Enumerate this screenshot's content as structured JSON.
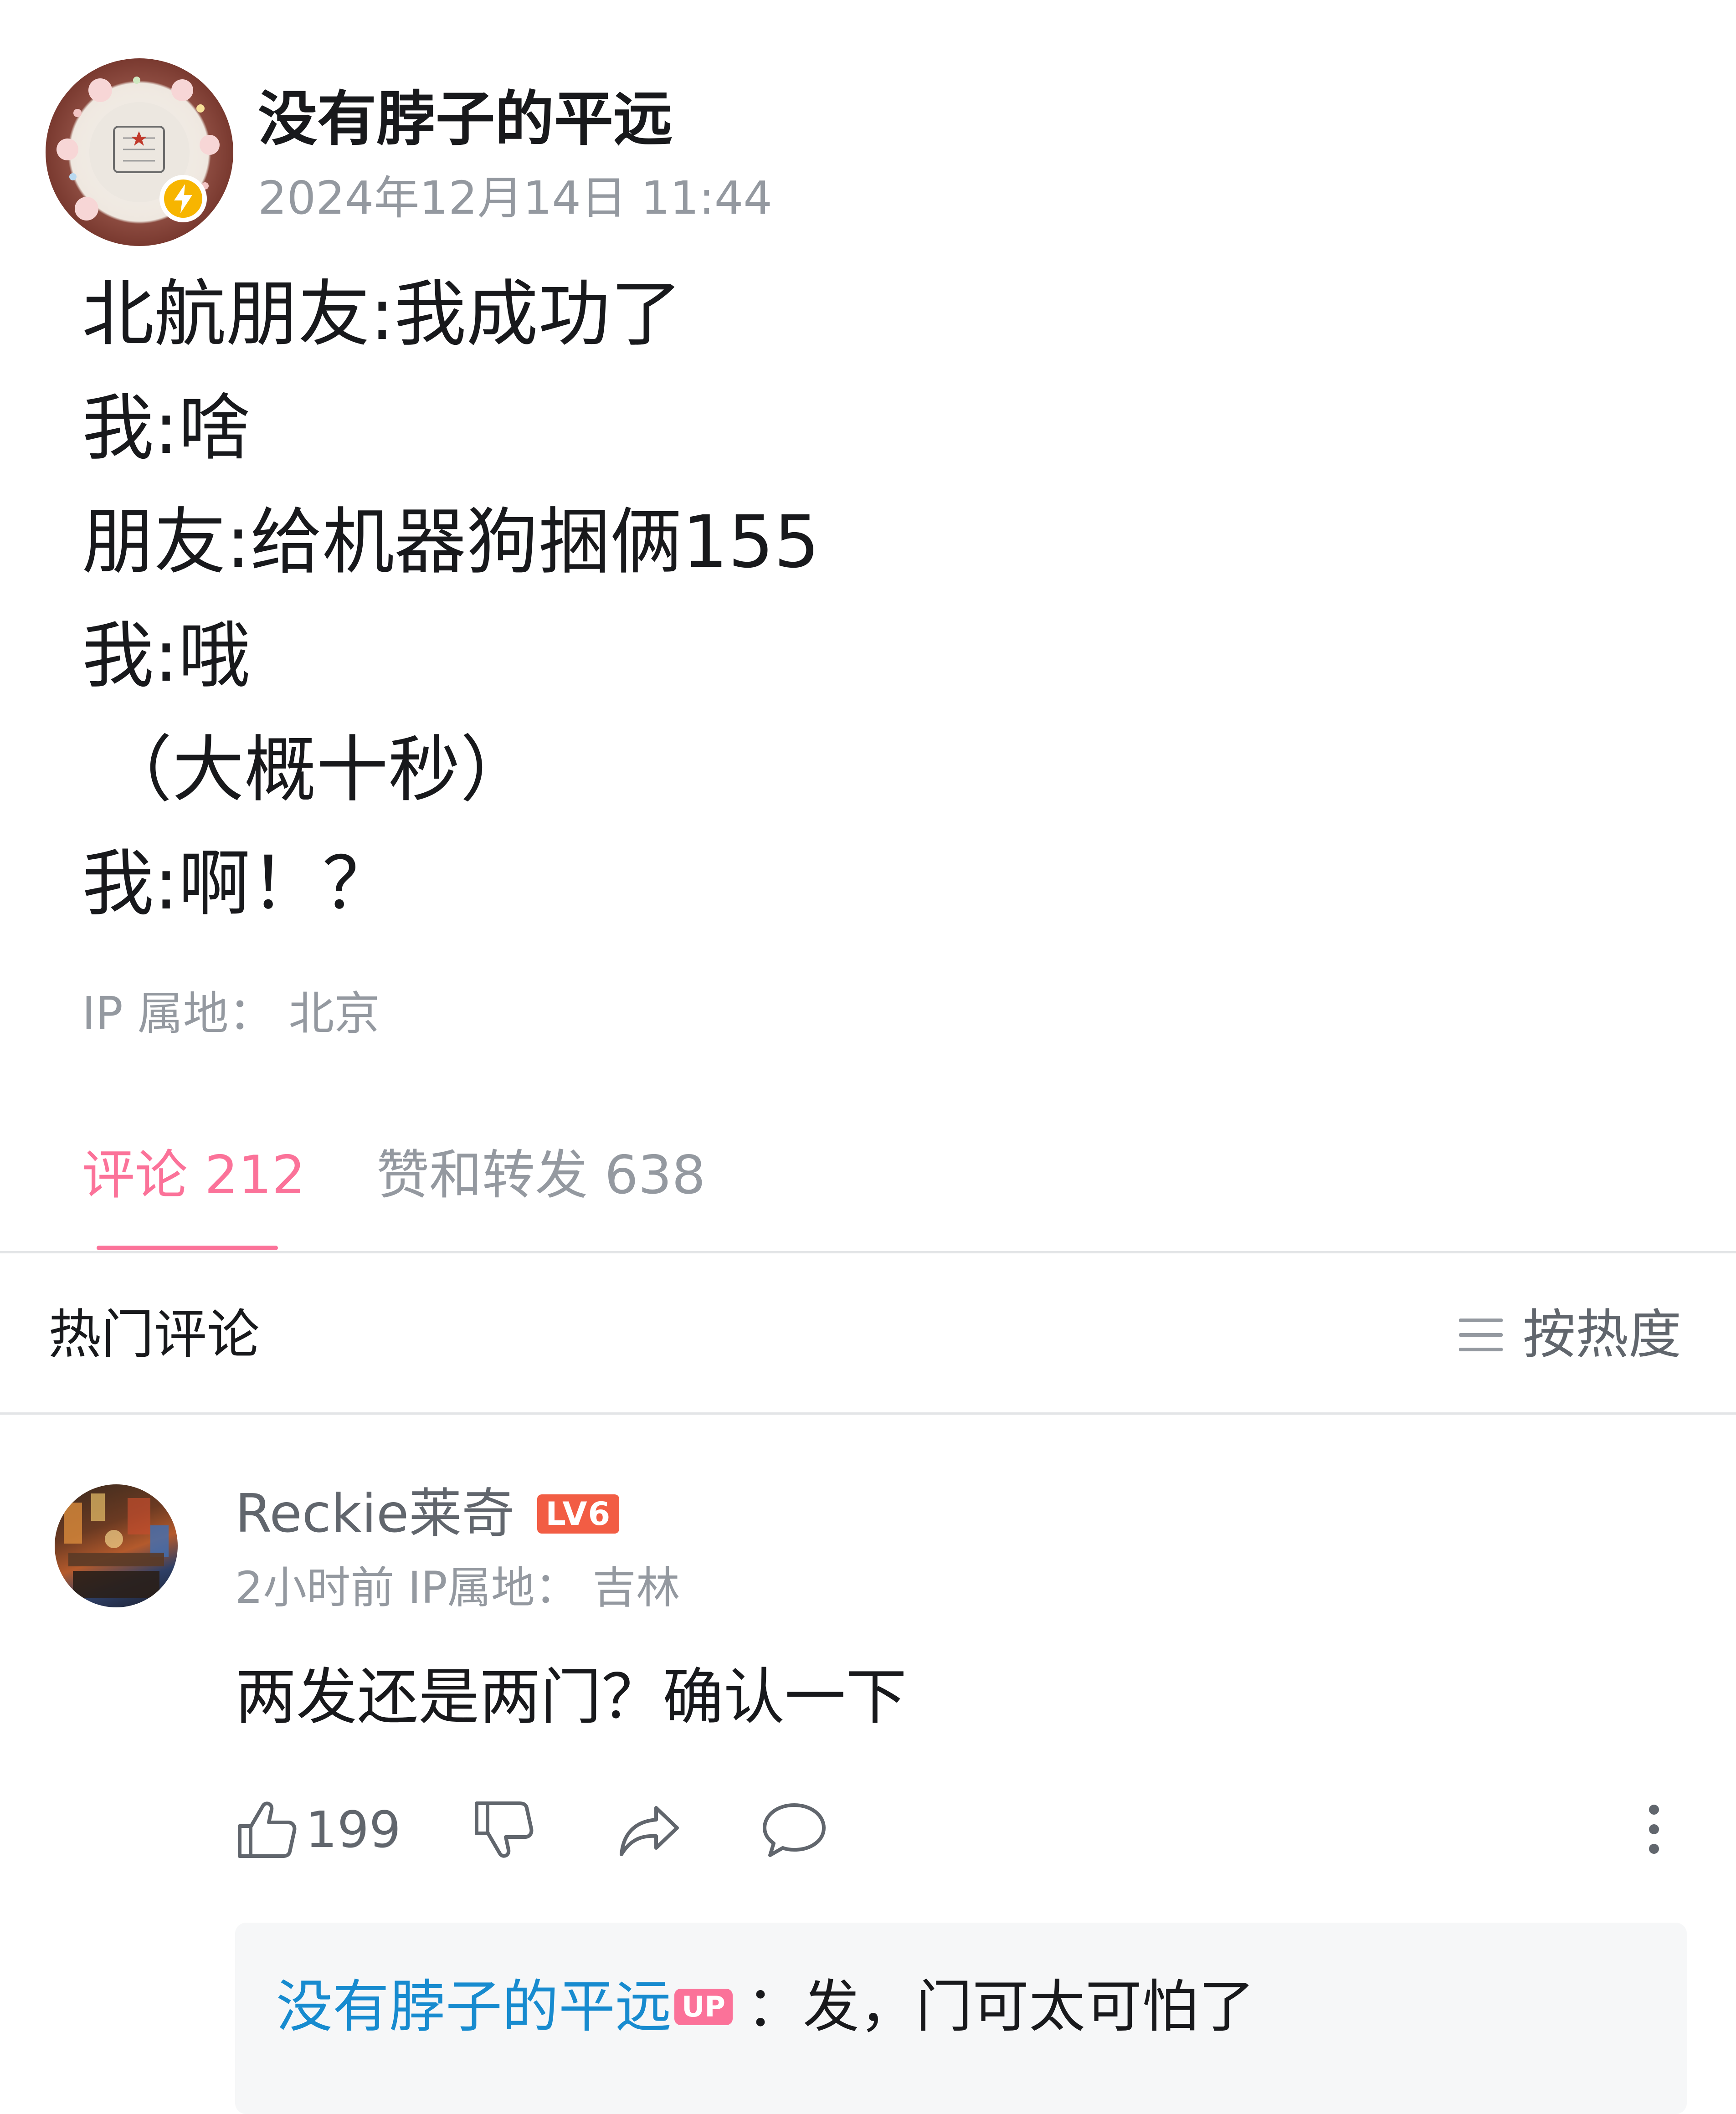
{
  "post": {
    "author": "没有脖子的平远",
    "time": "2024年12月14日 11:44",
    "lines": [
      "北航朋友:我成功了",
      "我:啥",
      "朋友:给机器狗捆俩155",
      "我:哦",
      "（大概十秒）",
      "我:啊！？"
    ],
    "ip_location": "IP 属地： 北京",
    "avatar_icon": "avatar-cartoon-icon",
    "badge_icon": "lightning-icon",
    "badge_color": "#f7b500"
  },
  "tabs": [
    {
      "label": "评论 212",
      "active": true
    },
    {
      "label": "赞和转发 638",
      "active": false
    }
  ],
  "comments_section": {
    "title": "热门评论",
    "sort_label": "按热度",
    "sort_icon": "menu-lines-icon"
  },
  "comment": {
    "username": "Reckie莱奇",
    "level": "LV6",
    "meta": "2小时前  IP属地： 吉林",
    "text": "两发还是两门？确认一下",
    "like_count": "199",
    "icons": [
      "thumb-up-icon",
      "thumb-down-icon",
      "share-icon",
      "reply-bubble-icon",
      "more-vertical-icon"
    ],
    "reply": {
      "author": "没有脖子的平远",
      "up_badge": "UP",
      "text": "：发，门可太可怕了"
    }
  },
  "colors": {
    "accent_pink": "#fb7299",
    "link_blue": "#178bcf",
    "level_red": "#f25d44",
    "muted_gray": "#9499a0",
    "text_dark": "#18191c"
  }
}
